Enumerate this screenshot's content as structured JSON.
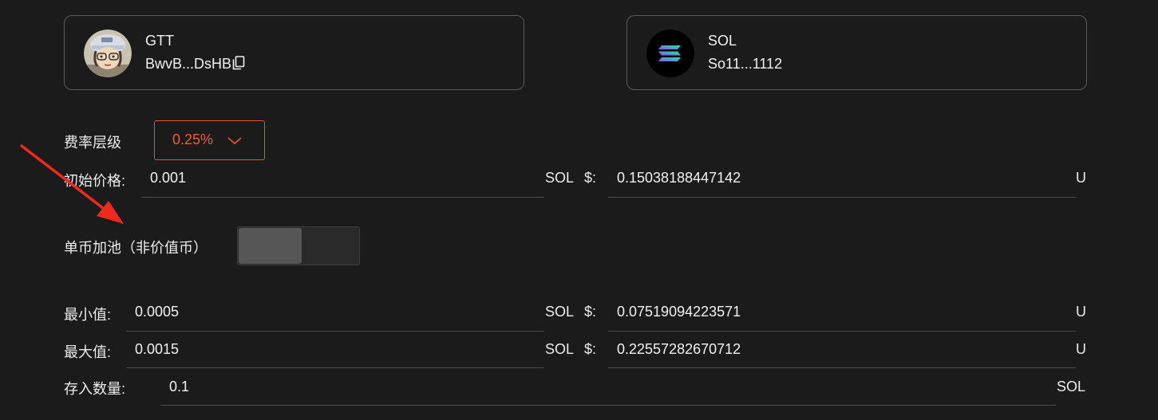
{
  "token_a": {
    "name": "GTT",
    "address": "BwvB...DsHB"
  },
  "token_b": {
    "name": "SOL",
    "address": "So11...1112"
  },
  "fee_tier": {
    "label": "费率层级",
    "value": "0.25%",
    "accent": "#f25a39"
  },
  "initial_price": {
    "label": "初始价格:",
    "value": "0.001",
    "unit": "SOL",
    "usd_label": "$:",
    "usd_value": "0.15038188447142",
    "usd_unit": "U"
  },
  "single_sided": {
    "label": "单币加池（非价值币）",
    "enabled": false
  },
  "min_value": {
    "label": "最小值:",
    "value": "0.0005",
    "unit": "SOL",
    "usd_label": "$:",
    "usd_value": "0.07519094223571",
    "usd_unit": "U"
  },
  "max_value": {
    "label": "最大值:",
    "value": "0.0015",
    "unit": "SOL",
    "usd_label": "$:",
    "usd_value": "0.22557282670712",
    "usd_unit": "U"
  },
  "deposit": {
    "label": "存入数量:",
    "value": "0.1",
    "unit": "SOL"
  },
  "annotation": {
    "arrow_color": "#ee2a1f"
  }
}
